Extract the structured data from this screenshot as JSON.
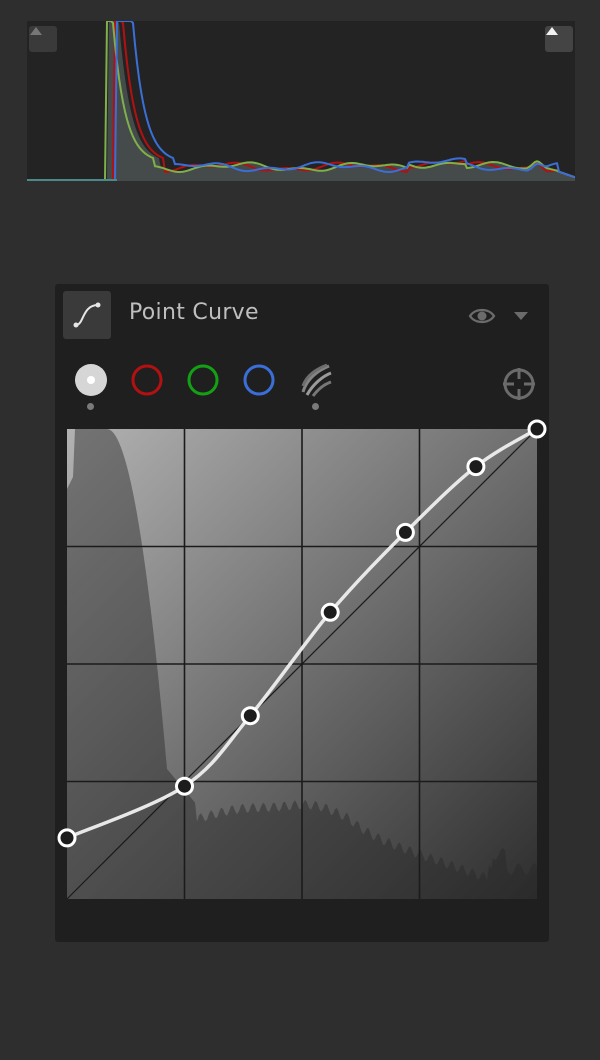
{
  "panel": {
    "title": "Point Curve"
  },
  "icons": {
    "tool": "point-curve-tool-icon",
    "visibility": "eye-icon",
    "menu": "chevron-down-icon",
    "target": "target-adjustment-icon",
    "clip_shadow": "triangle-up-icon",
    "clip_highlight": "triangle-up-icon"
  },
  "channels": [
    {
      "name": "rgb",
      "selected": true
    },
    {
      "name": "red"
    },
    {
      "name": "green"
    },
    {
      "name": "blue"
    },
    {
      "name": "luminance",
      "has_dot": true
    }
  ],
  "colors": {
    "red": "#b31111",
    "green": "#14a014",
    "blue": "#3b6fd8",
    "curve": "#e8e8e8"
  },
  "curve": {
    "points": [
      [
        0,
        0.13
      ],
      [
        0.25,
        0.24
      ],
      [
        0.39,
        0.39
      ],
      [
        0.56,
        0.61
      ],
      [
        0.72,
        0.78
      ],
      [
        0.87,
        0.92
      ],
      [
        1,
        1
      ]
    ]
  }
}
